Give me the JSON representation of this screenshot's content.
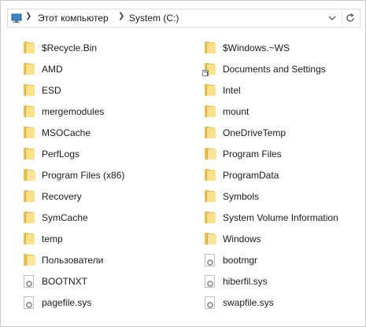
{
  "addressbar": {
    "breadcrumbs": [
      "Этот компьютер",
      "System (C:)"
    ],
    "icons": [
      "computer-icon",
      "chevron-down-icon",
      "refresh-icon"
    ]
  },
  "items": [
    {
      "name": "$Recycle.Bin",
      "icon": "folder-icon"
    },
    {
      "name": "$Windows.~WS",
      "icon": "folder-icon"
    },
    {
      "name": "AMD",
      "icon": "folder-icon"
    },
    {
      "name": "Documents and Settings",
      "icon": "folder-shortcut-icon"
    },
    {
      "name": "ESD",
      "icon": "folder-icon"
    },
    {
      "name": "Intel",
      "icon": "folder-icon"
    },
    {
      "name": "mergemodules",
      "icon": "folder-icon"
    },
    {
      "name": "mount",
      "icon": "folder-icon"
    },
    {
      "name": "MSOCache",
      "icon": "folder-icon"
    },
    {
      "name": "OneDriveTemp",
      "icon": "folder-icon"
    },
    {
      "name": "PerfLogs",
      "icon": "folder-icon"
    },
    {
      "name": "Program Files",
      "icon": "folder-icon"
    },
    {
      "name": "Program Files (x86)",
      "icon": "folder-icon"
    },
    {
      "name": "ProgramData",
      "icon": "folder-icon"
    },
    {
      "name": "Recovery",
      "icon": "folder-icon"
    },
    {
      "name": "Symbols",
      "icon": "folder-icon"
    },
    {
      "name": "SymCache",
      "icon": "folder-icon"
    },
    {
      "name": "System Volume Information",
      "icon": "folder-icon"
    },
    {
      "name": "temp",
      "icon": "folder-icon"
    },
    {
      "name": "Windows",
      "icon": "folder-icon"
    },
    {
      "name": "Пользователи",
      "icon": "folder-icon"
    },
    {
      "name": "bootmgr",
      "icon": "system-file-icon"
    },
    {
      "name": "BOOTNXT",
      "icon": "system-file-icon"
    },
    {
      "name": "hiberfil.sys",
      "icon": "system-file-icon"
    },
    {
      "name": "pagefile.sys",
      "icon": "system-file-icon"
    },
    {
      "name": "swapfile.sys",
      "icon": "system-file-icon"
    }
  ]
}
